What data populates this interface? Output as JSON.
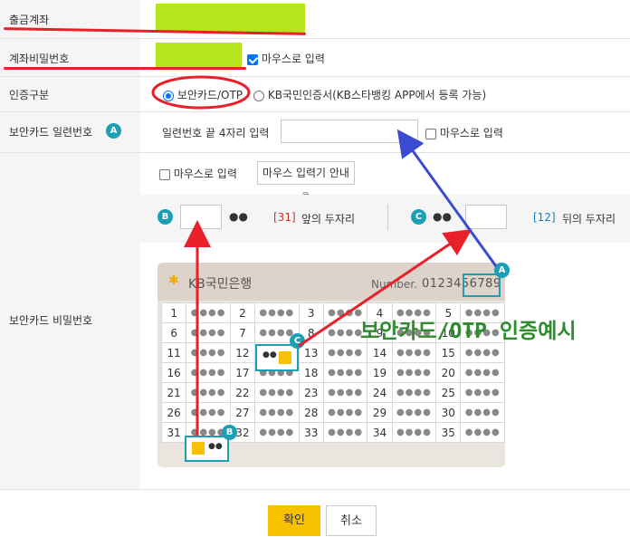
{
  "labels": {
    "withdraw_account": "출금계좌",
    "account_password": "계좌비밀번호",
    "auth_type": "인증구분",
    "card_serial": "보안카드 일련번호",
    "card_password": "보안카드 비밀번호"
  },
  "password_row": {
    "mouse_input_label": "마우스로 입력"
  },
  "auth": {
    "option_card": "보안카드/OTP",
    "option_cert": "KB국민인증서(KB스타뱅킹 APP에서 등록 가능)"
  },
  "serial": {
    "prompt": "일련번호 끝 4자리 입력",
    "mouse_input_label": "마우스로 입력",
    "badge": "A"
  },
  "card_pw": {
    "mouse_input_label": "마우스로 입력",
    "guide_button": "마우스 입력기 안내",
    "badge_b": "B",
    "badge_c": "C",
    "dots": "●●",
    "front_num": "[31]",
    "front_text": "앞의 두자리",
    "back_num": "[12]",
    "back_text": "뒤의 두자리"
  },
  "card": {
    "bank": "KB국민은행",
    "number_label": "Number.",
    "number_value": "0123456789",
    "dots": "●●●●",
    "cells": [
      [
        "1",
        "2",
        "3",
        "4",
        "5"
      ],
      [
        "6",
        "7",
        "8",
        "9",
        "10"
      ],
      [
        "11",
        "12",
        "13",
        "14",
        "15"
      ],
      [
        "16",
        "17",
        "18",
        "19",
        "20"
      ],
      [
        "21",
        "22",
        "23",
        "24",
        "25"
      ],
      [
        "26",
        "27",
        "28",
        "29",
        "30"
      ],
      [
        "31",
        "32",
        "33",
        "34",
        "35"
      ]
    ],
    "highlight_c_dots": "●●",
    "highlight_b_dots": "●●"
  },
  "example_caption": "보안카드/OTP 인증예시",
  "buttons": {
    "confirm": "확인",
    "cancel": "취소"
  },
  "colors": {
    "highlight": "#b5e61d",
    "annotation_red": "#e8202a",
    "annotation_blue": "#3a4bd1",
    "teal": "#1b9fb5",
    "confirm": "#f7c000"
  }
}
